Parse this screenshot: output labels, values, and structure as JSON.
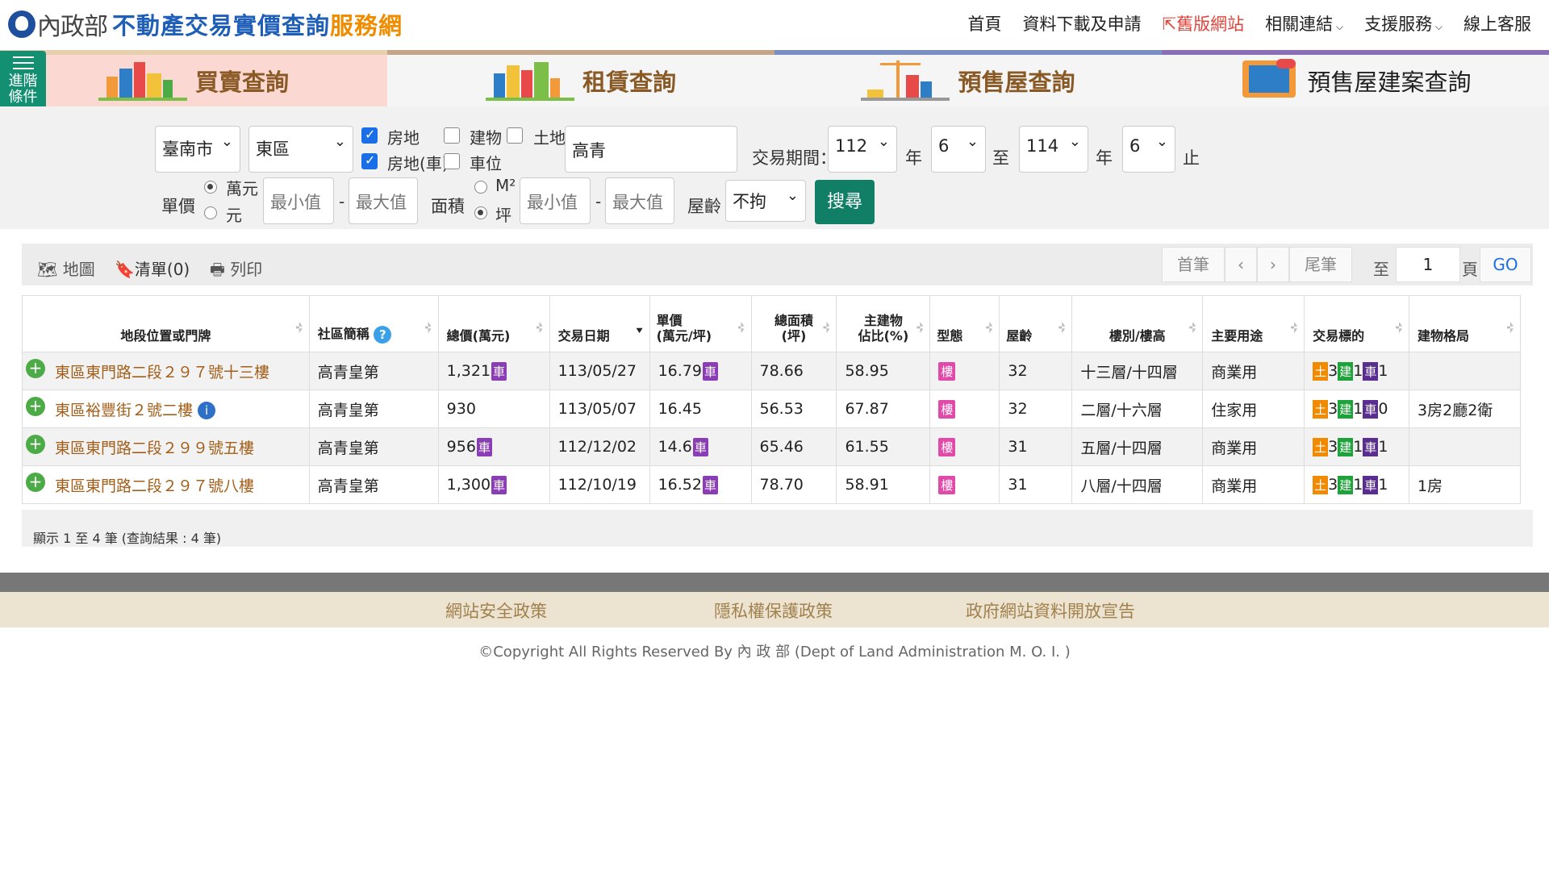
{
  "header": {
    "ministry": "內政部",
    "site_title": "不動產交易實價查詢",
    "site_title_suffix": "服務網",
    "nav": [
      "首頁",
      "資料下載及申請",
      "舊版網站",
      "相關連結",
      "支援服務",
      "線上客服"
    ]
  },
  "tabs": [
    {
      "label": "買賣查詢",
      "active": true
    },
    {
      "label": "租賃查詢",
      "active": false
    },
    {
      "label": "預售屋查詢",
      "active": false
    },
    {
      "label": "預售屋建案查詢",
      "active": false
    }
  ],
  "advanced_label": "進階條件",
  "search": {
    "city": "臺南市",
    "district": "東區",
    "opt_house_land": "房地",
    "opt_building": "建物",
    "opt_land": "土地",
    "opt_house_land_car": "房地(車)",
    "opt_parking": "車位",
    "keyword": "高青",
    "period_label": "交易期間：",
    "from_year": "112",
    "from_month": "6",
    "to_year": "114",
    "to_month": "6",
    "year_unit": "年",
    "to_label": "至",
    "end_label": "止",
    "unit_price_label": "單價",
    "unit_wan": "萬元",
    "unit_yuan": "元",
    "min_placeholder": "最小值",
    "max_placeholder": "最大值",
    "dash": "-",
    "area_label": "面積",
    "area_m2": "M²",
    "area_ping": "坪",
    "age_label": "屋齡",
    "age_value": "不拘",
    "search_button": "搜尋"
  },
  "toolbar": {
    "map": "地圖",
    "list": "清單(0)",
    "print": "列印",
    "first": "首筆",
    "prev": "‹",
    "next": "›",
    "last": "尾筆",
    "to": "至",
    "page": "1",
    "page_unit": "頁",
    "go": "GO"
  },
  "table": {
    "headers": [
      "地段位置或門牌",
      "社區簡稱",
      "總價(萬元)",
      "交易日期",
      "單價\n(萬元/坪)",
      "總面積\n(坪)",
      "主建物\n佔比(%)",
      "型態",
      "屋齡",
      "樓別/樓高",
      "主要用途",
      "交易標的",
      "建物格局"
    ],
    "rows": [
      {
        "addr": "東區東門路二段２９７號十三樓",
        "community": "高青皇第",
        "total": "1,321",
        "total_car": true,
        "date": "113/05/27",
        "unit": "16.79",
        "unit_car": true,
        "area": "78.66",
        "ratio": "58.95",
        "type": "樓",
        "age": "32",
        "floor": "十三層/十四層",
        "use": "商業用",
        "land": "3",
        "build": "1",
        "car": "1",
        "layout": ""
      },
      {
        "addr": "東區裕豐街２號二樓",
        "community": "高青皇第",
        "total": "930",
        "total_car": false,
        "date": "113/05/07",
        "unit": "16.45",
        "unit_car": false,
        "area": "56.53",
        "ratio": "67.87",
        "type": "樓",
        "age": "32",
        "floor": "二層/十六層",
        "use": "住家用",
        "land": "3",
        "build": "1",
        "car": "0",
        "layout": "3房2廳2衛"
      },
      {
        "addr": "東區東門路二段２９９號五樓",
        "community": "高青皇第",
        "total": "956",
        "total_car": true,
        "date": "112/12/02",
        "unit": "14.6",
        "unit_car": true,
        "area": "65.46",
        "ratio": "61.55",
        "type": "樓",
        "age": "31",
        "floor": "五層/十四層",
        "use": "商業用",
        "land": "3",
        "build": "1",
        "car": "1",
        "layout": ""
      },
      {
        "addr": "東區東門路二段２９７號八樓",
        "community": "高青皇第",
        "total": "1,300",
        "total_car": true,
        "date": "112/10/19",
        "unit": "16.52",
        "unit_car": true,
        "area": "78.70",
        "ratio": "58.91",
        "type": "樓",
        "age": "31",
        "floor": "八層/十四層",
        "use": "商業用",
        "land": "3",
        "build": "1",
        "car": "1",
        "layout": "1房"
      }
    ],
    "car_badge": "車",
    "land_badge": "土",
    "build_badge": "建",
    "car_tag": "車"
  },
  "summary": "顯示 1 至 4 筆 (查詢結果 : 4 筆)",
  "footer": {
    "links": [
      "網站安全政策",
      "隱私權保護政策",
      "政府網站資料開放宣告"
    ],
    "copyright": "©Copyright All Rights Reserved By 內 政 部 (Dept of Land Administration M. O. I. )"
  }
}
